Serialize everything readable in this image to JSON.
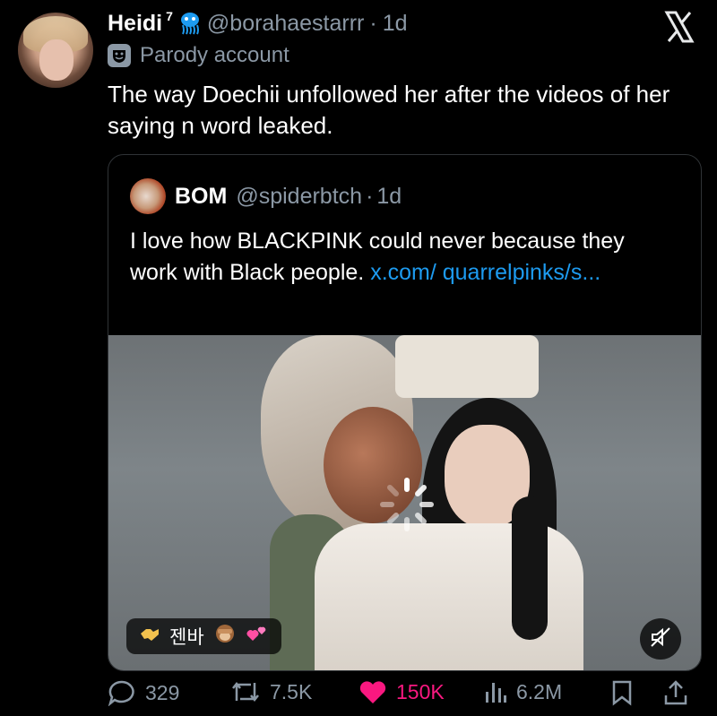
{
  "author": {
    "display_name": "Heidi",
    "name_suffix": "7",
    "badge_icon": "jellyfish-icon",
    "handle": "@borahaestarrr",
    "separator": "·",
    "time": "1d",
    "label": "Parody account",
    "label_icon": "theater-mask-icon"
  },
  "tweet_text": "The way Doechii unfollowed her after the videos of her saying n word leaked.",
  "app_logo": "x-logo-icon",
  "quoted": {
    "display_name": "BOM",
    "handle": "@spiderbtch",
    "separator": "·",
    "time": "1d",
    "text": "I love how BLACKPINK could never because they work with Black people.",
    "link_text": "x.com/ quarrelpinks/s...",
    "media": {
      "chip_text": "젠바",
      "chip_icons": [
        "handshake-icon",
        "see-no-evil-monkey-icon",
        "two-hearts-icon"
      ],
      "loading_icon": "spinner-icon",
      "mute_icon": "speaker-muted-icon"
    }
  },
  "actions": {
    "replies": "329",
    "reposts": "7.5K",
    "likes": "150K",
    "views": "6.2M"
  },
  "colors": {
    "background": "#000000",
    "muted": "#8b98a5",
    "link": "#1d9bf0",
    "like": "#f91880"
  }
}
